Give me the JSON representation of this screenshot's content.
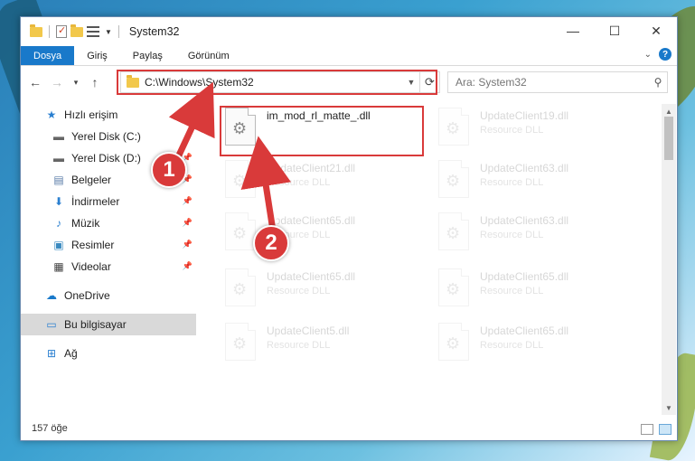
{
  "window": {
    "title": "System32",
    "controls": {
      "minimize": "—",
      "maximize": "☐",
      "close": "✕"
    }
  },
  "ribbon": {
    "tabs": [
      {
        "label": "Dosya",
        "active": true
      },
      {
        "label": "Giriş"
      },
      {
        "label": "Paylaş"
      },
      {
        "label": "Görünüm"
      }
    ],
    "help": "?"
  },
  "address": {
    "path": "C:\\Windows\\System32"
  },
  "search": {
    "placeholder": "Ara: System32"
  },
  "sidebar": {
    "items": [
      {
        "label": "Hızlı erişim",
        "icon": "star-icon"
      },
      {
        "label": "Yerel Disk (C:)",
        "icon": "drive-icon",
        "pinned": true
      },
      {
        "label": "Yerel Disk (D:)",
        "icon": "drive-icon",
        "pinned": true
      },
      {
        "label": "Belgeler",
        "icon": "document-icon",
        "pinned": true
      },
      {
        "label": "İndirmeler",
        "icon": "download-icon",
        "pinned": true
      },
      {
        "label": "Müzik",
        "icon": "music-icon",
        "pinned": true
      },
      {
        "label": "Resimler",
        "icon": "pictures-icon",
        "pinned": true
      },
      {
        "label": "Videolar",
        "icon": "video-icon",
        "pinned": true
      },
      {
        "label": "OneDrive",
        "icon": "cloud-icon"
      },
      {
        "label": "Bu bilgisayar",
        "icon": "computer-icon",
        "selected": true
      },
      {
        "label": "Ağ",
        "icon": "network-icon"
      }
    ]
  },
  "files": [
    {
      "name": "im_mod_rl_matte_.dll",
      "type": "",
      "highlighted": true
    },
    {
      "name": "UpdateClient19.dll",
      "type": "Resource DLL"
    },
    {
      "name": "UpdateClient21.dll",
      "type": "Resource DLL"
    },
    {
      "name": "UpdateClient63.dll",
      "type": "Resource DLL"
    },
    {
      "name": "UpdateClient65.dll",
      "type": "Resource DLL"
    },
    {
      "name": "UpdateClient63.dll",
      "type": "Resource DLL"
    },
    {
      "name": "UpdateClient65.dll",
      "type": "Resource DLL"
    },
    {
      "name": "UpdateClient65.dll",
      "type": "Resource DLL"
    },
    {
      "name": "UpdateClient5.dll",
      "type": "Resource DLL"
    },
    {
      "name": "UpdateClient65.dll",
      "type": "Resource DLL"
    }
  ],
  "status": {
    "count": "157 öğe"
  },
  "annotations": {
    "step1": "1",
    "step2": "2"
  },
  "colors": {
    "accent": "#1979ca",
    "annotation": "#d93a3a"
  }
}
